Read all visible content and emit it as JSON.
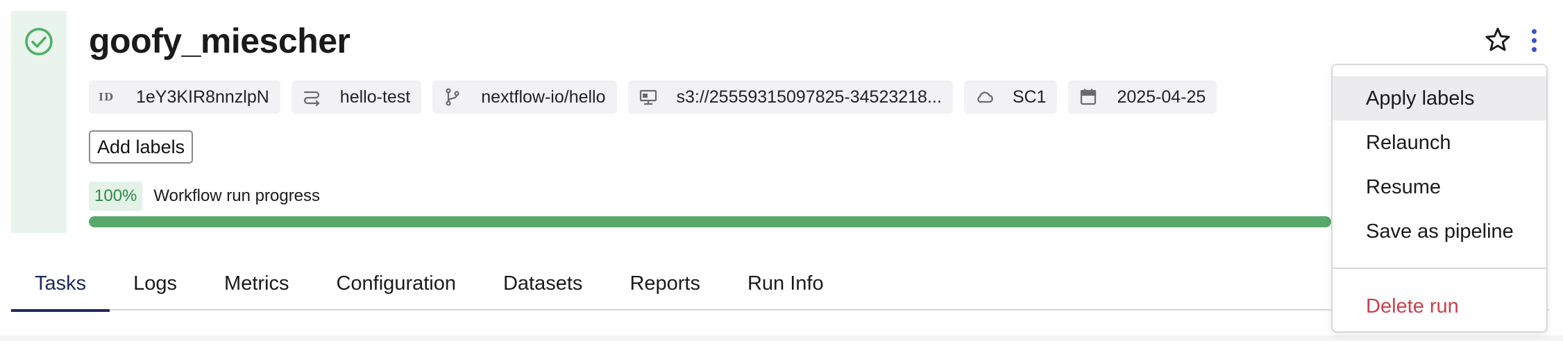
{
  "run": {
    "name": "goofy_miescher",
    "status": "succeeded",
    "status_color": "#4caf64"
  },
  "chips": [
    {
      "icon": "id-icon",
      "icon_text": "ID",
      "label": "1eY3KIR8nnzlpN"
    },
    {
      "icon": "workflow-icon",
      "label": "hello-test"
    },
    {
      "icon": "git-branch-icon",
      "label": "nextflow-io/hello"
    },
    {
      "icon": "workdir-icon",
      "label": "s3://25559315097825-34523218..."
    },
    {
      "icon": "cloud-icon",
      "label": "SC1"
    },
    {
      "icon": "calendar-icon",
      "label": "2025-04-25"
    }
  ],
  "labels": {
    "add_button": "Add labels"
  },
  "progress": {
    "percent_text": "100%",
    "value": 1.0,
    "label": "Workflow run progress",
    "fill_color": "#58a86a"
  },
  "tabs": [
    {
      "label": "Tasks",
      "active": true
    },
    {
      "label": "Logs"
    },
    {
      "label": "Metrics"
    },
    {
      "label": "Configuration"
    },
    {
      "label": "Datasets"
    },
    {
      "label": "Reports"
    },
    {
      "label": "Run Info"
    }
  ],
  "menu": {
    "items": [
      "Apply labels",
      "Relaunch",
      "Resume",
      "Save as pipeline"
    ],
    "danger_item": "Delete run",
    "danger_color": "#c9404a"
  },
  "accent_color": "#3b4fc8"
}
